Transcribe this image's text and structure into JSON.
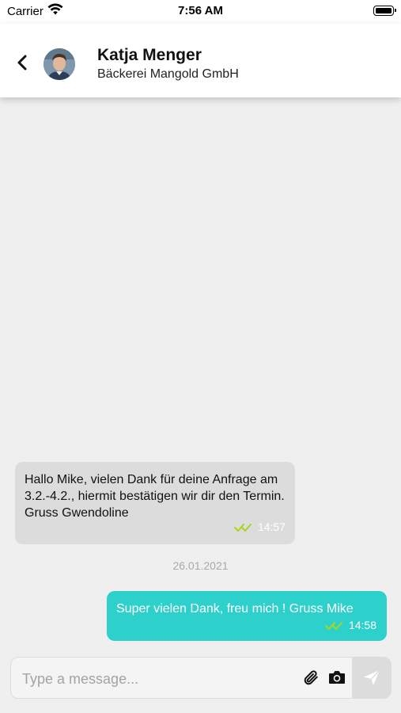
{
  "status_bar": {
    "carrier": "Carrier",
    "time": "7:56 AM"
  },
  "header": {
    "contact_name": "Katja Menger",
    "company": "Bäckerei Mangold GmbH"
  },
  "messages": [
    {
      "direction": "incoming",
      "text": "Hallo Mike, vielen Dank für deine Anfrage am 3.2.-4.2., hiermit bestätigen wir dir den Termin. Gruss Gwendoline",
      "time": "14:57",
      "status": "read"
    },
    {
      "direction": "outgoing",
      "text": "Super vielen Dank, freu mich ! Gruss Mike",
      "time": "14:58",
      "status": "read"
    }
  ],
  "date_separator": "26.01.2021",
  "composer": {
    "placeholder": "Type a message...",
    "value": ""
  },
  "icons": {
    "back": "chevron-left-icon",
    "attach": "paperclip-icon",
    "camera": "camera-icon",
    "send": "send-icon",
    "read": "double-check-icon"
  },
  "colors": {
    "outgoing_bubble": "#2ed0cc",
    "incoming_bubble": "#dcdcdd",
    "read_check": "#a6d61e",
    "background": "#efeff0"
  }
}
